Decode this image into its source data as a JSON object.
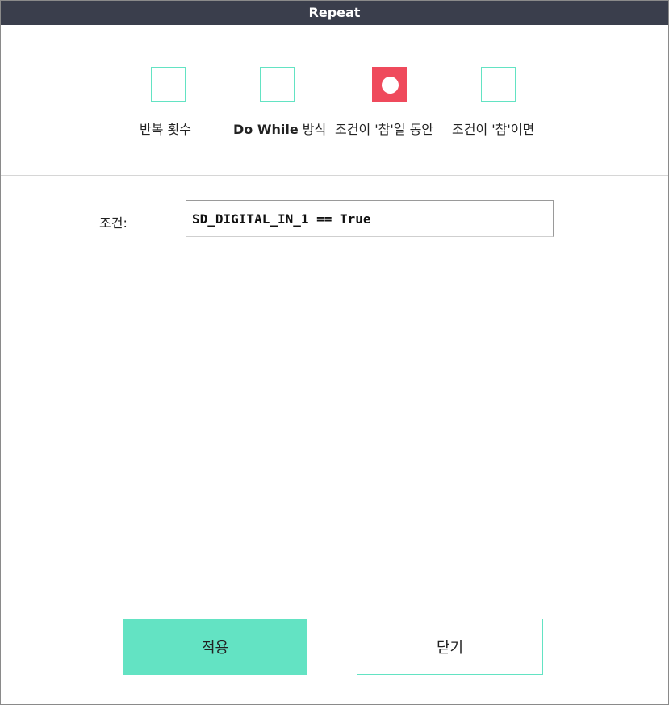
{
  "window": {
    "title": "Repeat"
  },
  "options": [
    {
      "label_prefix": "",
      "label": "반복 횟수",
      "selected": false
    },
    {
      "label_prefix": "Do While",
      "label": " 방식",
      "selected": false
    },
    {
      "label_prefix": "",
      "label": "조건이 '참'일 동안",
      "selected": true
    },
    {
      "label_prefix": "",
      "label": "조건이 '참'이면",
      "selected": false
    }
  ],
  "condition": {
    "label": "조건:",
    "value": "SD_DIGITAL_IN_1 == True"
  },
  "buttons": {
    "apply": "적용",
    "close": "닫기"
  },
  "colors": {
    "accent": "#63e3c3",
    "selected": "#ef4a5c",
    "titlebar": "#3a3e4c"
  }
}
